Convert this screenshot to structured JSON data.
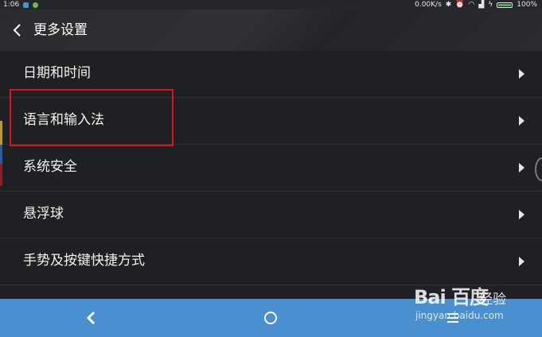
{
  "status_bar": {
    "time": "1:06",
    "network_speed": "0.00K/s",
    "battery_percent": "100%",
    "battery_level": 1.0
  },
  "header": {
    "title": "更多设置",
    "back_icon": "chevron-left-icon"
  },
  "settings": {
    "items": [
      {
        "label": "日期和时间"
      },
      {
        "label": "语言和输入法"
      },
      {
        "label": "系统安全"
      },
      {
        "label": "悬浮球"
      },
      {
        "label": "手势及按键快捷方式"
      }
    ]
  },
  "nav_bar": {
    "back_icon": "back-triangle-icon",
    "home_icon": "home-circle-icon",
    "menu_icon": "menu-lines-icon"
  },
  "watermark": {
    "brand": "Bai 百度",
    "label": "经验",
    "url": "jingyan.baidu.com"
  },
  "colors": {
    "background": "#1f2024",
    "nav_bar": "#4a8fd0",
    "highlight_box": "#e0121b",
    "battery": "#4caf50"
  }
}
